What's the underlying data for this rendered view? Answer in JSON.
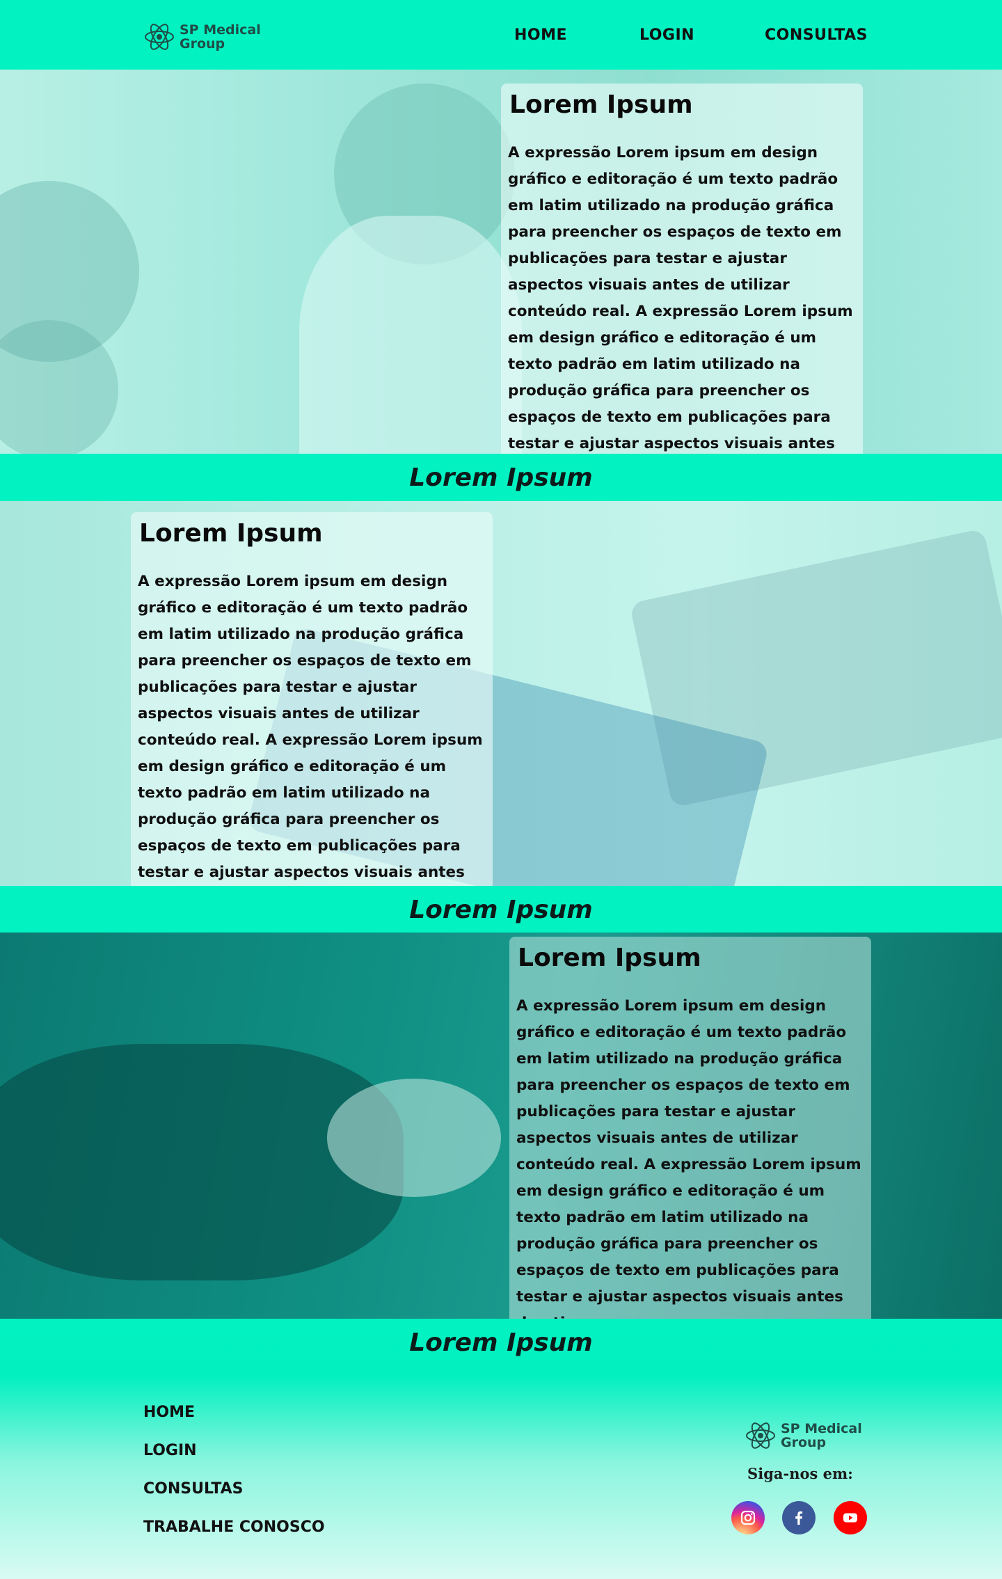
{
  "header": {
    "logo_line1": "SP Medical",
    "logo_line2": "Group",
    "nav": [
      "HOME",
      "LOGIN",
      "CONSULTAS"
    ]
  },
  "sections": [
    {
      "card_title": "Lorem Ipsum",
      "card_text": "A expressão Lorem ipsum em design gráfico e editoração é um texto padrão em latim utilizado na produção gráfica para preencher os espaços de texto em publicações para testar e ajustar aspectos visuais antes de utilizar conteúdo real. A expressão Lorem ipsum em design gráfico e editoração é um texto padrão em latim utilizado na produção gráfica para preencher os espaços de texto em publicações para testar e ajustar aspectos visuais antes de uti",
      "band_title": "Lorem Ipsum"
    },
    {
      "card_title": "Lorem Ipsum",
      "card_text": "A expressão Lorem ipsum em design gráfico e editoração é um texto padrão em latim utilizado na produção gráfica para preencher os espaços de texto em publicações para testar e ajustar aspectos visuais antes de utilizar conteúdo real. A expressão Lorem ipsum em design gráfico e editoração é um texto padrão em latim utilizado na produção gráfica para preencher os espaços de texto em publicações para testar e ajustar aspectos visuais antes de uti",
      "band_title": "Lorem Ipsum"
    },
    {
      "card_title": "Lorem Ipsum",
      "card_text": "A expressão Lorem ipsum em design gráfico e editoração é um texto padrão em latim utilizado na produção gráfica para preencher os espaços de texto em publicações para testar e ajustar aspectos visuais antes de utilizar conteúdo real. A expressão Lorem ipsum em design gráfico e editoração é um texto padrão em latim utilizado na produção gráfica para preencher os espaços de texto em publicações para testar e ajustar aspectos visuais antes de uti",
      "band_title": "Lorem Ipsum"
    }
  ],
  "footer": {
    "links": [
      "HOME",
      "LOGIN",
      "CONSULTAS",
      "TRABALHE CONOSCO"
    ],
    "logo_line1": "SP Medical",
    "logo_line2": "Group",
    "follow_text": "Siga-nos em:",
    "social": [
      "instagram-icon",
      "facebook-icon",
      "youtube-icon"
    ]
  },
  "colors": {
    "accent": "#03f2c2",
    "logo_text": "#1f4d47",
    "instagram": "#d6249f",
    "facebook": "#3b5998",
    "youtube": "#ff0000"
  }
}
